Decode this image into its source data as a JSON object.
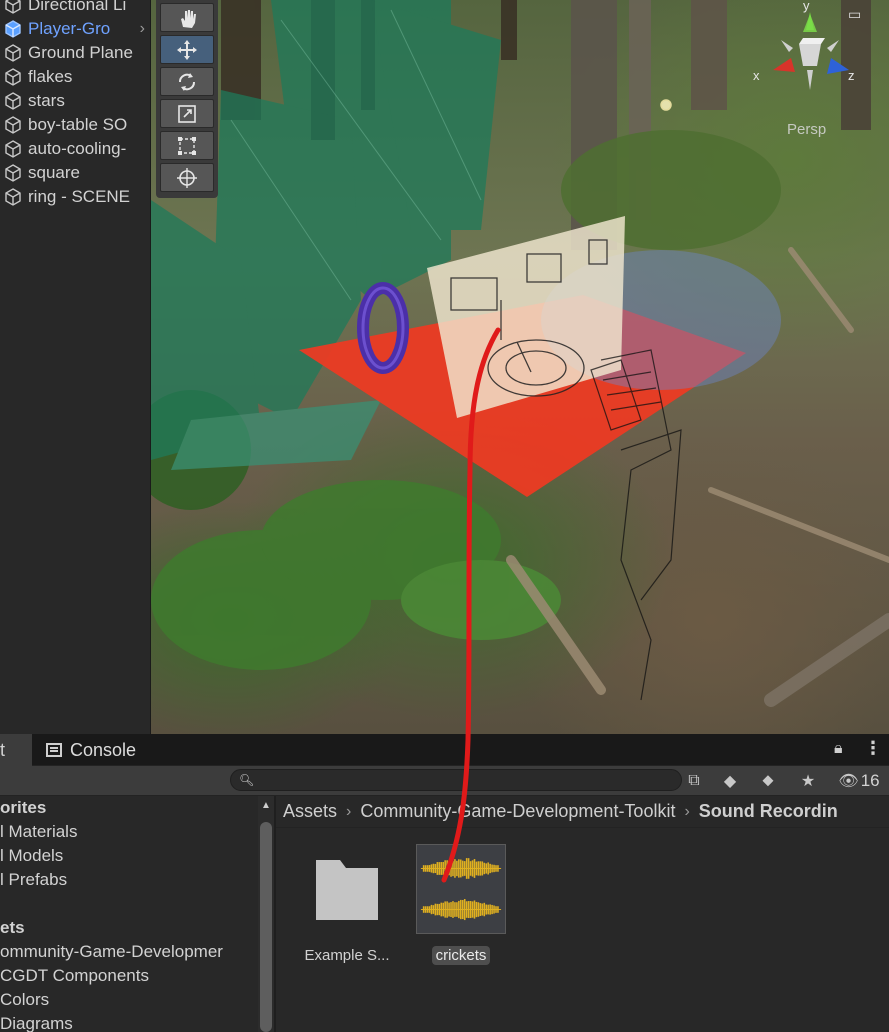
{
  "hierarchy": {
    "items": [
      {
        "label": "Directional Li",
        "selected": false
      },
      {
        "label": "Player-Gro",
        "selected": true,
        "has_children": true
      },
      {
        "label": "Ground Plane",
        "selected": false
      },
      {
        "label": "flakes",
        "selected": false
      },
      {
        "label": "stars",
        "selected": false
      },
      {
        "label": "boy-table SO",
        "selected": false
      },
      {
        "label": "auto-cooling-",
        "selected": false
      },
      {
        "label": "square",
        "selected": false
      },
      {
        "label": "ring - SCENE",
        "selected": false
      }
    ]
  },
  "scene": {
    "tools": [
      {
        "name": "hand-tool",
        "icon": "hand-icon",
        "active": false
      },
      {
        "name": "move-tool",
        "icon": "move-icon",
        "active": true
      },
      {
        "name": "rotate-tool",
        "icon": "rotate-icon",
        "active": false
      },
      {
        "name": "scale-tool",
        "icon": "scale-icon",
        "active": false
      },
      {
        "name": "rect-tool",
        "icon": "rect-icon",
        "active": false
      },
      {
        "name": "transform-tool",
        "icon": "transform-icon",
        "active": false
      }
    ],
    "gizmo": {
      "y": "y",
      "x": "x",
      "z": "z",
      "projection": "Persp"
    },
    "colors": {
      "ground_plane": "#f03a22",
      "ring": "#4b2fa8",
      "flakes": "#1f7a5a",
      "annotation": "#e01a1a"
    }
  },
  "bottom_panel": {
    "tabs": {
      "project_fragment": "t",
      "console": "Console"
    },
    "search": {
      "placeholder": "",
      "value": ""
    },
    "hidden_count": "16",
    "tree": [
      {
        "label": "orites",
        "bold": true
      },
      {
        "label": "l Materials",
        "bold": false
      },
      {
        "label": "l Models",
        "bold": false
      },
      {
        "label": "l Prefabs",
        "bold": false
      },
      {
        "label": "",
        "bold": false
      },
      {
        "label": "ets",
        "bold": true
      },
      {
        "label": "ommunity-Game-Developmer",
        "bold": false
      },
      {
        "label": " CGDT Components",
        "bold": false
      },
      {
        "label": " Colors",
        "bold": false
      },
      {
        "label": " Diagrams",
        "bold": false
      }
    ],
    "breadcrumb": [
      "Assets",
      "Community-Game-Development-Toolkit",
      "Sound Recordin"
    ],
    "assets": [
      {
        "label": "Example S...",
        "type": "folder"
      },
      {
        "label": "crickets",
        "type": "audio",
        "selected": true
      }
    ]
  }
}
